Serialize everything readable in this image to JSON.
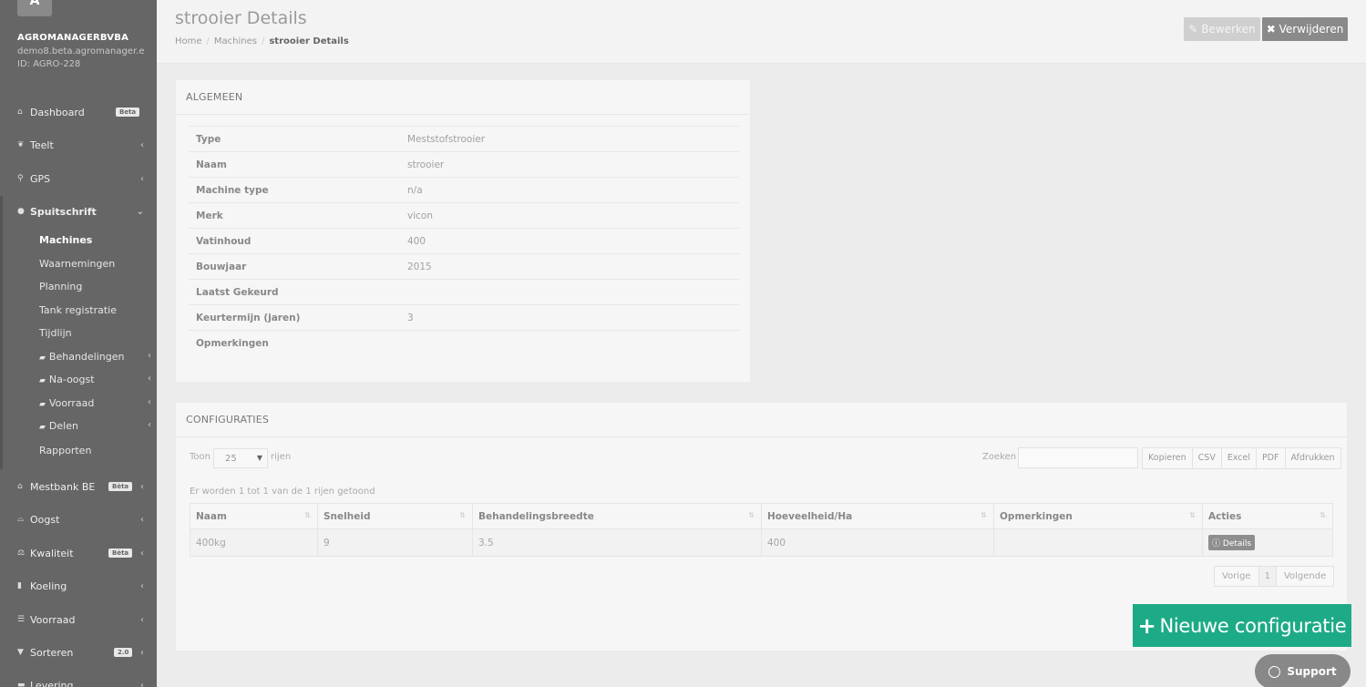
{
  "sidebar": {
    "logo_letter": "A",
    "org_name": "AGROMANAGERBVBA",
    "org_domain": "demo8.beta.agromanager.e",
    "org_id": "ID: AGRO-228",
    "items": [
      {
        "label": "Dashboard",
        "badge": "Beta"
      },
      {
        "label": "Teelt"
      },
      {
        "label": "GPS"
      },
      {
        "label": "Spuitschrift"
      },
      {
        "label": "Mestbank BE",
        "badge": "Bèta"
      },
      {
        "label": "Oogst"
      },
      {
        "label": "Kwaliteit",
        "badge": "Bèta"
      },
      {
        "label": "Koeling"
      },
      {
        "label": "Voorraad"
      },
      {
        "label": "Sorteren",
        "badge": "2.0"
      },
      {
        "label": "Levering"
      }
    ],
    "sub_items": [
      {
        "label": "Machines"
      },
      {
        "label": "Waarnemingen"
      },
      {
        "label": "Planning"
      },
      {
        "label": "Tank registratie"
      },
      {
        "label": "Tijdlijn"
      },
      {
        "label": "Behandelingen"
      },
      {
        "label": "Na-oogst"
      },
      {
        "label": "Voorraad"
      },
      {
        "label": "Delen"
      },
      {
        "label": "Rapporten"
      }
    ]
  },
  "header": {
    "title": "strooier Details",
    "breadcrumb": [
      "Home",
      "Machines",
      "strooier Details"
    ],
    "edit_label": "Bewerken",
    "delete_label": "Verwijderen"
  },
  "general": {
    "title": "ALGEMEEN",
    "rows": [
      {
        "label": "Type",
        "value": "Meststofstrooier"
      },
      {
        "label": "Naam",
        "value": "strooier"
      },
      {
        "label": "Machine type",
        "value": "n/a"
      },
      {
        "label": "Merk",
        "value": "vicon"
      },
      {
        "label": "Vatinhoud",
        "value": "400"
      },
      {
        "label": "Bouwjaar",
        "value": "2015"
      },
      {
        "label": "Laatst Gekeurd",
        "value": ""
      },
      {
        "label": "Keurtermijn (jaren)",
        "value": "3"
      },
      {
        "label": "Opmerkingen",
        "value": ""
      }
    ]
  },
  "configs": {
    "title": "CONFIGURATIES",
    "show_label": "Toon",
    "show_value": "25",
    "rows_label": "rijen",
    "search_label": "Zoeken",
    "export_buttons": [
      "Kopieren",
      "CSV",
      "Excel",
      "PDF",
      "Afdrukken"
    ],
    "info": "Er worden 1 tot 1 van de 1 rijen getoond",
    "columns": [
      "Naam",
      "Snelheid",
      "Behandelingsbreedte",
      "Hoeveelheid/Ha",
      "Opmerkingen",
      "Acties"
    ],
    "rows": [
      {
        "naam": "400kg",
        "snelheid": "9",
        "breedte": "3.5",
        "hoeveelheid": "400",
        "opmerkingen": "",
        "actie": "Details"
      }
    ],
    "pager": {
      "prev": "Vorige",
      "page": "1",
      "next": "Volgende"
    }
  },
  "floating": {
    "new_config": "Nieuwe configuratie",
    "support": "Support"
  }
}
